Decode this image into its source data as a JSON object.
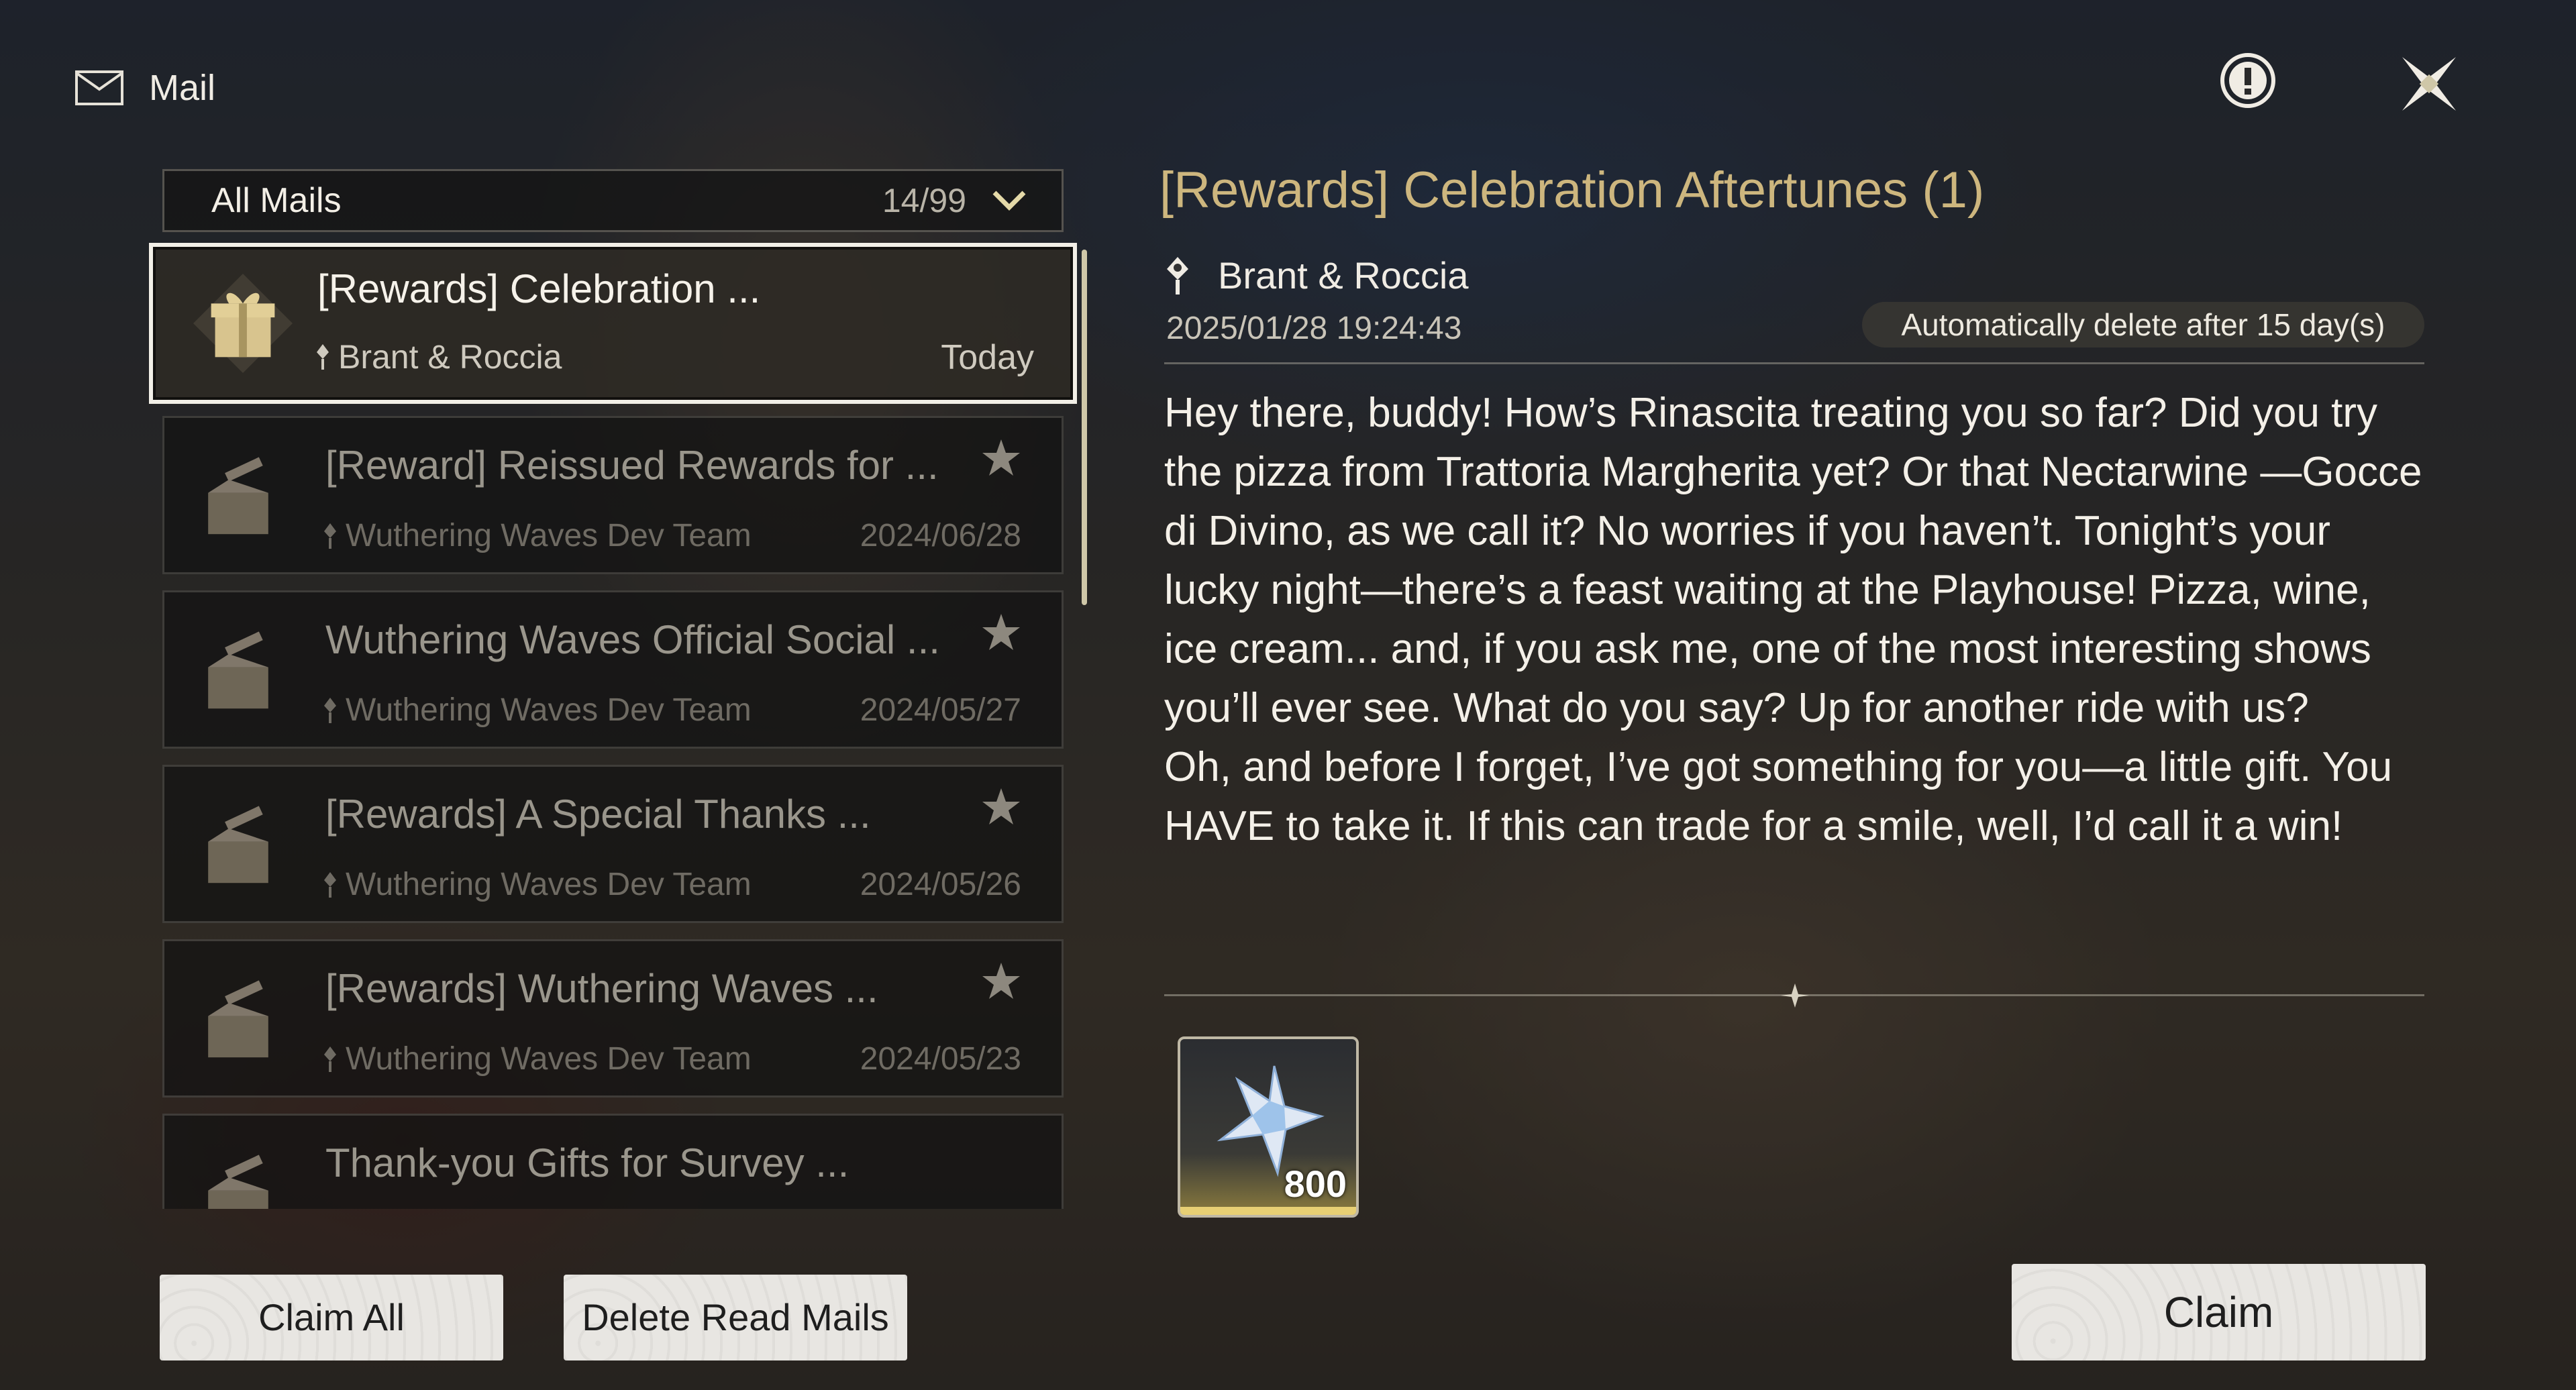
{
  "header": {
    "title": "Mail"
  },
  "filter": {
    "label": "All Mails",
    "count": "14/99"
  },
  "mails": [
    {
      "subject": "[Rewards] Celebration ...",
      "sender": "Brant & Roccia",
      "date": "Today",
      "starred": false,
      "icon": "gift-box-icon"
    },
    {
      "subject": "[Reward] Reissued Rewards for ...",
      "sender": "Wuthering Waves Dev Team",
      "date": "2024/06/28",
      "starred": true,
      "icon": "opened-package-icon"
    },
    {
      "subject": "Wuthering Waves Official Social ...",
      "sender": "Wuthering Waves Dev Team",
      "date": "2024/05/27",
      "starred": true,
      "icon": "opened-package-icon"
    },
    {
      "subject": "[Rewards] A Special Thanks ...",
      "sender": "Wuthering Waves Dev Team",
      "date": "2024/05/26",
      "starred": true,
      "icon": "opened-package-icon"
    },
    {
      "subject": "[Rewards] Wuthering Waves ...",
      "sender": "Wuthering Waves Dev Team",
      "date": "2024/05/23",
      "starred": true,
      "icon": "opened-package-icon"
    },
    {
      "subject": "Thank-you Gifts for Survey ...",
      "sender": "",
      "date": "",
      "starred": false,
      "icon": "opened-package-icon"
    }
  ],
  "detail": {
    "title": "[Rewards] Celebration Aftertunes (1)",
    "sender": "Brant & Roccia",
    "timestamp": "2025/01/28 19:24:43",
    "auto_delete": "Automatically delete after 15 day(s)",
    "body": "Hey there, buddy! How’s Rinascita treating you so far? Did you try the pizza from Trattoria Margherita yet? Or that Nectarwine —Gocce di Divino, as we call it? No worries if you haven’t. Tonight’s your lucky night—there’s a feast waiting at the Playhouse! Pizza, wine, ice cream... and, if you ask me, one of the most interesting shows you’ll ever see. What do you say? Up for another ride with us?\nOh, and before I forget, I’ve got something for you—a little gift. You HAVE to take it. If this can trade for a smile, well, I’d call it a win!",
    "reward": {
      "quantity": "800",
      "icon": "astrite-crystal-icon"
    }
  },
  "buttons": {
    "claim_all": "Claim All",
    "delete_read": "Delete Read Mails",
    "claim": "Claim"
  },
  "colors": {
    "title_gold": "#cdb67e",
    "button_bg": "#e8e6e2"
  }
}
